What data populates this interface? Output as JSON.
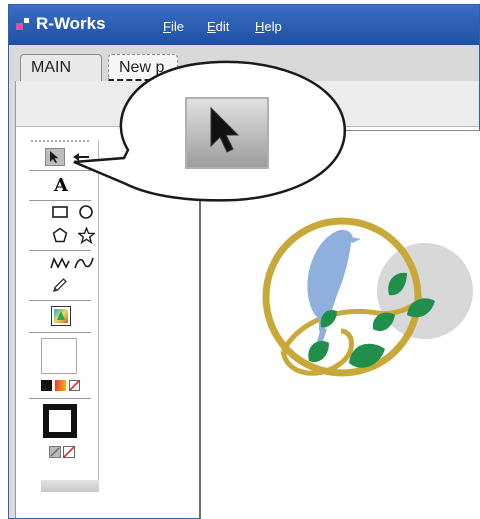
{
  "app": {
    "title": "R-Works"
  },
  "menu": {
    "file": {
      "first": "F",
      "rest": "ile"
    },
    "edit": {
      "first": "E",
      "rest": "dit"
    },
    "help": {
      "first": "H",
      "rest": "elp"
    }
  },
  "tabs": [
    {
      "label": "MAIN",
      "active": false
    },
    {
      "label": "New p",
      "active": true
    }
  ],
  "tools": {
    "text_tool": "A",
    "icons": [
      "select-arrow-icon",
      "direct-select-icon",
      "text-icon",
      "rectangle-icon",
      "ellipse-icon",
      "polygon-icon",
      "star-icon",
      "polyline-icon",
      "freehand-icon",
      "pencil-icon",
      "gradient-icon",
      "swatch-black-icon",
      "swatch-gradient-icon",
      "swatch-none-icon",
      "stroke-width-icon",
      "stroke-color-icon",
      "stroke-none-icon"
    ]
  },
  "zoom_callout": {
    "icon": "select-arrow-icon"
  },
  "artwork": {
    "icon": "bird-on-branch-logo",
    "colors": {
      "ring": "#c9a83a",
      "bird": "#8fb0dc",
      "moon": "#d8d8d8",
      "leaf": "#1f8f4b",
      "branch": "#c9a83a"
    }
  },
  "colors": {
    "titlebar": "#2a5db0",
    "accent": "#e24ea3"
  }
}
